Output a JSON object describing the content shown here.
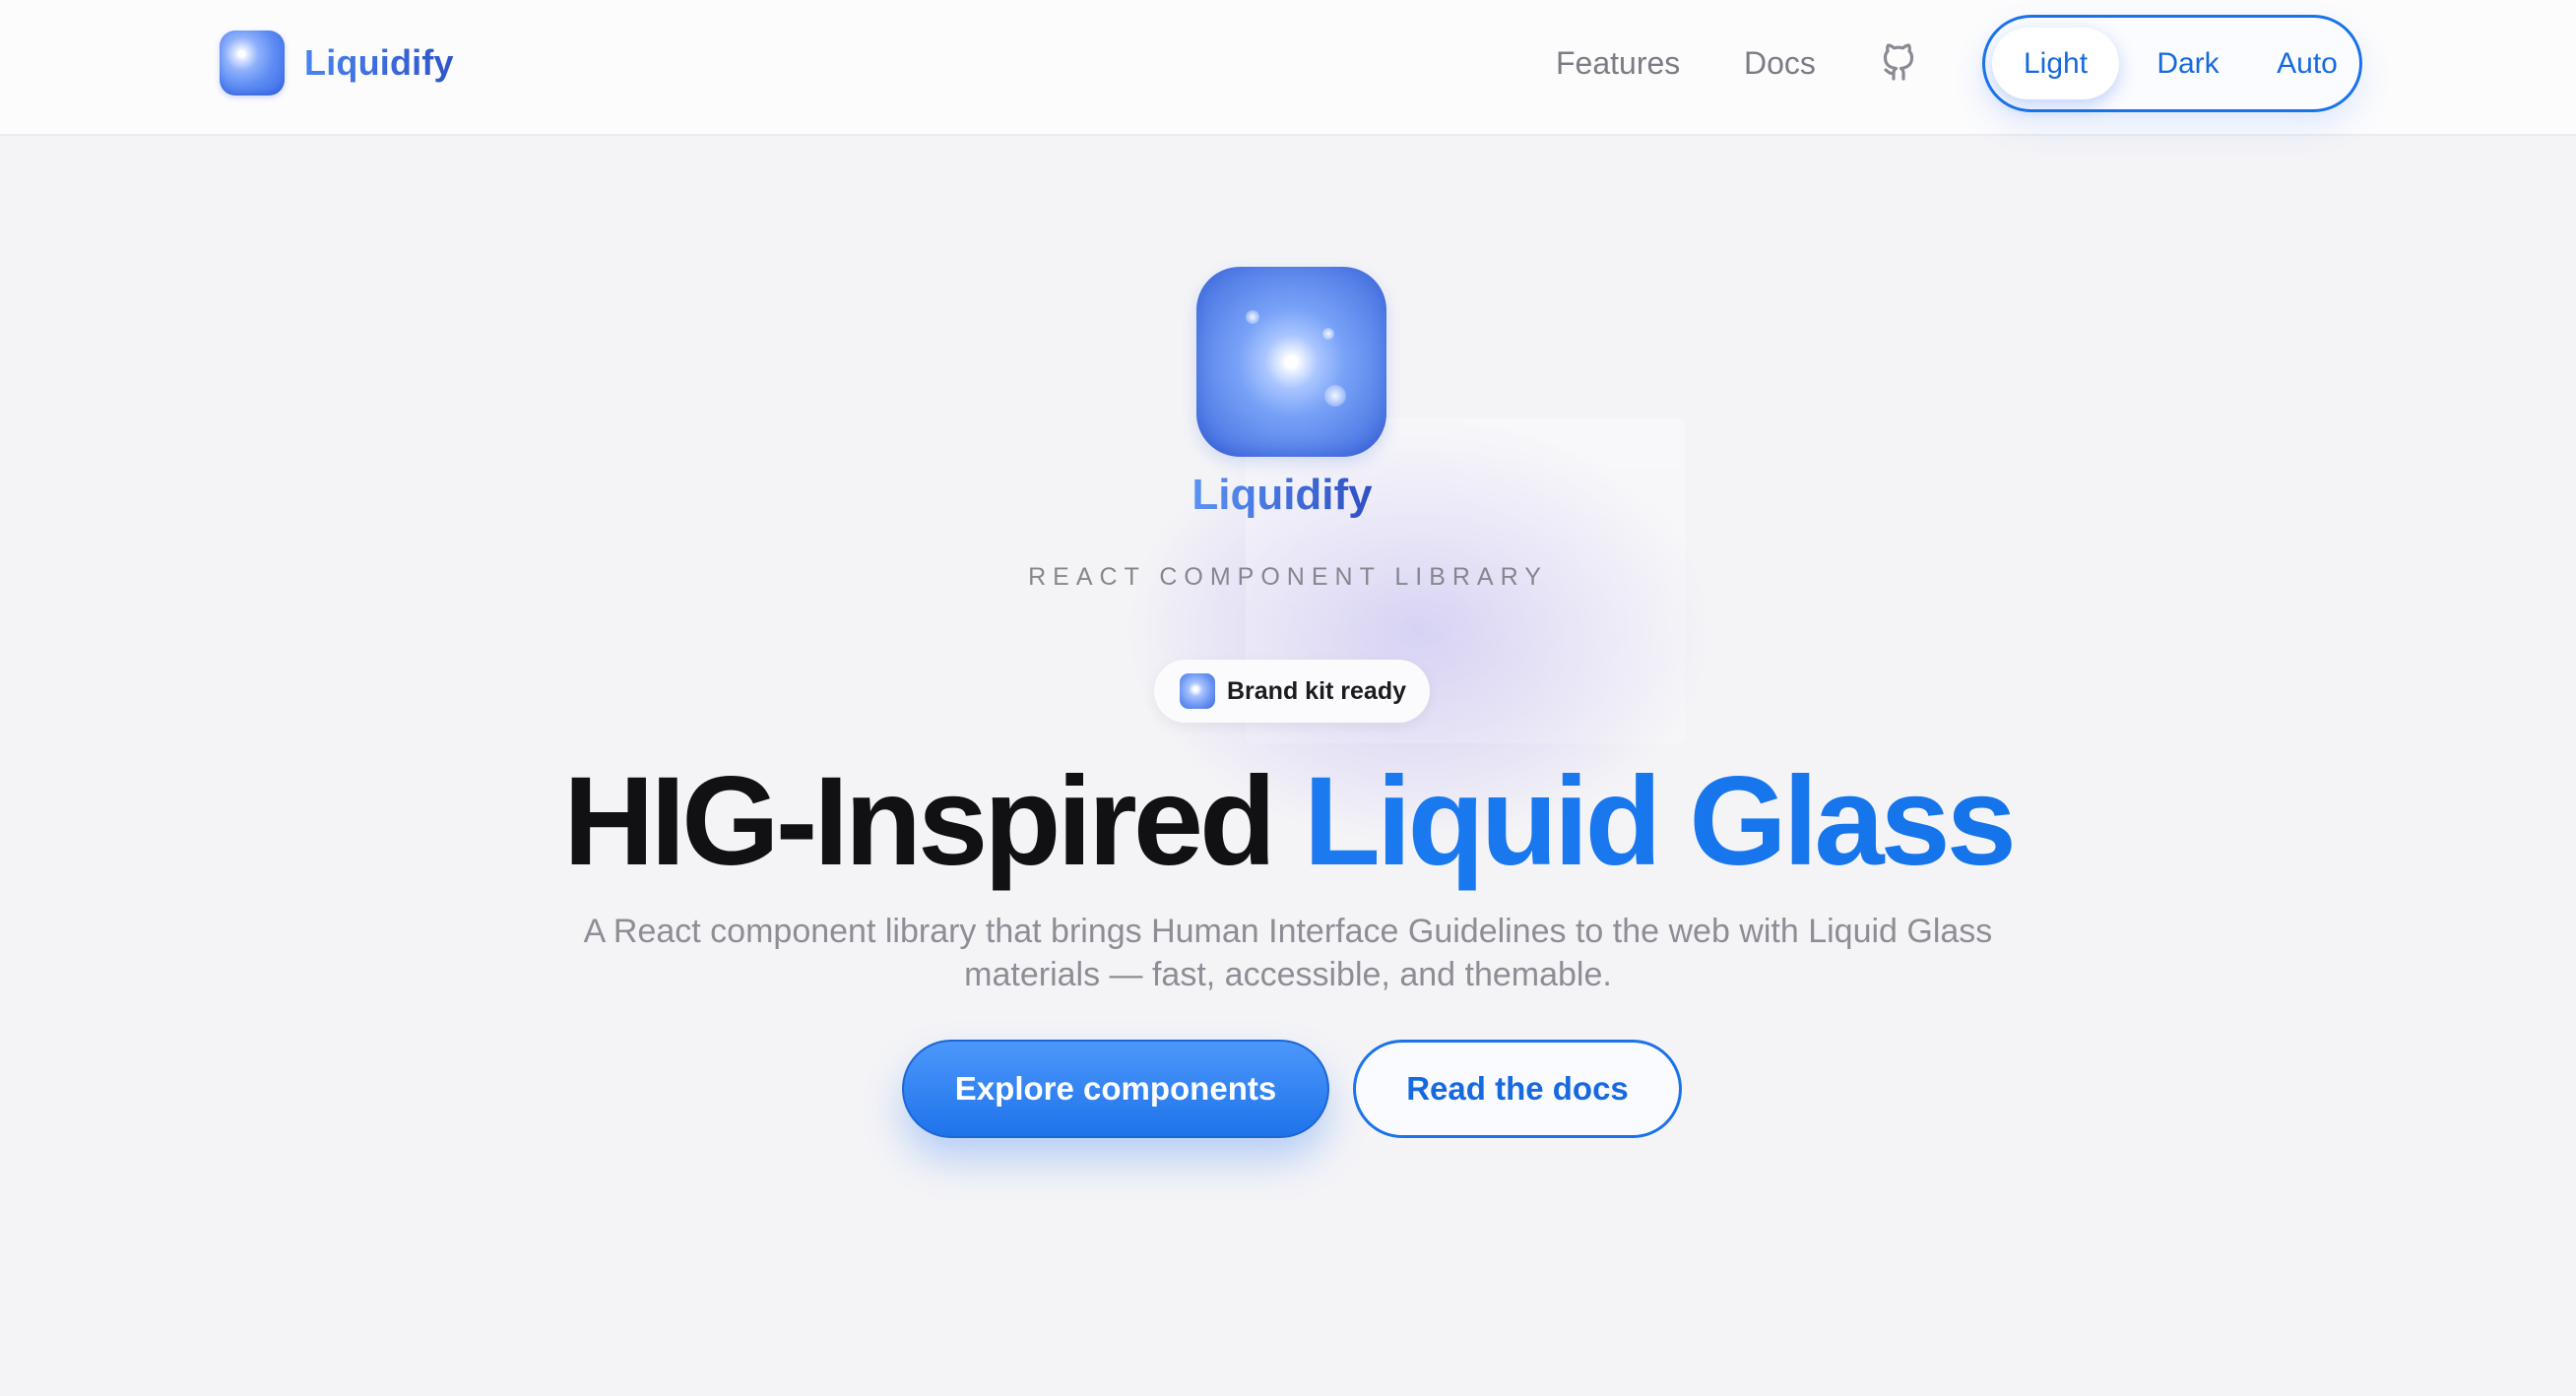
{
  "nav": {
    "brand": "Liquidify",
    "links": [
      "Features",
      "Docs"
    ],
    "github_icon": "github-icon",
    "theme_options": [
      "Light",
      "Dark",
      "Auto"
    ],
    "theme_selected": "Light"
  },
  "hero": {
    "brand": "Liquidify",
    "eyebrow": "REACT COMPONENT LIBRARY",
    "badge": "Brand kit ready",
    "headline_plain": "HIG-Inspired",
    "headline_accent": "Liquid Glass",
    "subtitle": "A React component library that brings Human Interface Guidelines to the web with Liquid Glass materials — fast, accessible, and themable.",
    "primary_cta": "Explore components",
    "secondary_cta": "Read the docs"
  },
  "colors": {
    "accent": "#1a73e8",
    "background": "#f4f4f7",
    "text": "#111114",
    "muted": "#8d8d95"
  }
}
